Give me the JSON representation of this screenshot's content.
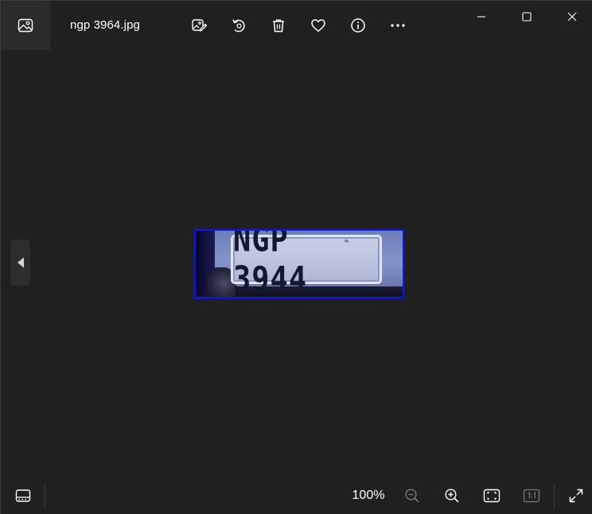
{
  "window": {
    "file_name": "ngp 3964.jpg"
  },
  "toolbar": {
    "items": [
      {
        "name": "edit-image",
        "icon": "edit-image-icon"
      },
      {
        "name": "rotate",
        "icon": "rotate-icon"
      },
      {
        "name": "delete",
        "icon": "trash-icon"
      },
      {
        "name": "favorite",
        "icon": "heart-icon"
      },
      {
        "name": "file-info",
        "icon": "info-icon"
      },
      {
        "name": "more",
        "icon": "more-icon"
      }
    ]
  },
  "window_controls": {
    "items": [
      "minimize",
      "maximize",
      "close"
    ]
  },
  "image": {
    "plate_text": "NGP 3944",
    "border_color": "#0a14ff"
  },
  "bottom_bar": {
    "zoom_level": "100%",
    "items": [
      "filmstrip",
      "zoom-out",
      "zoom-in",
      "fit-to-window",
      "actual-size",
      "full-screen"
    ]
  },
  "colors": {
    "background": "#202020",
    "icon": "#ffffff",
    "icon_disabled": "#7a7a7a"
  }
}
